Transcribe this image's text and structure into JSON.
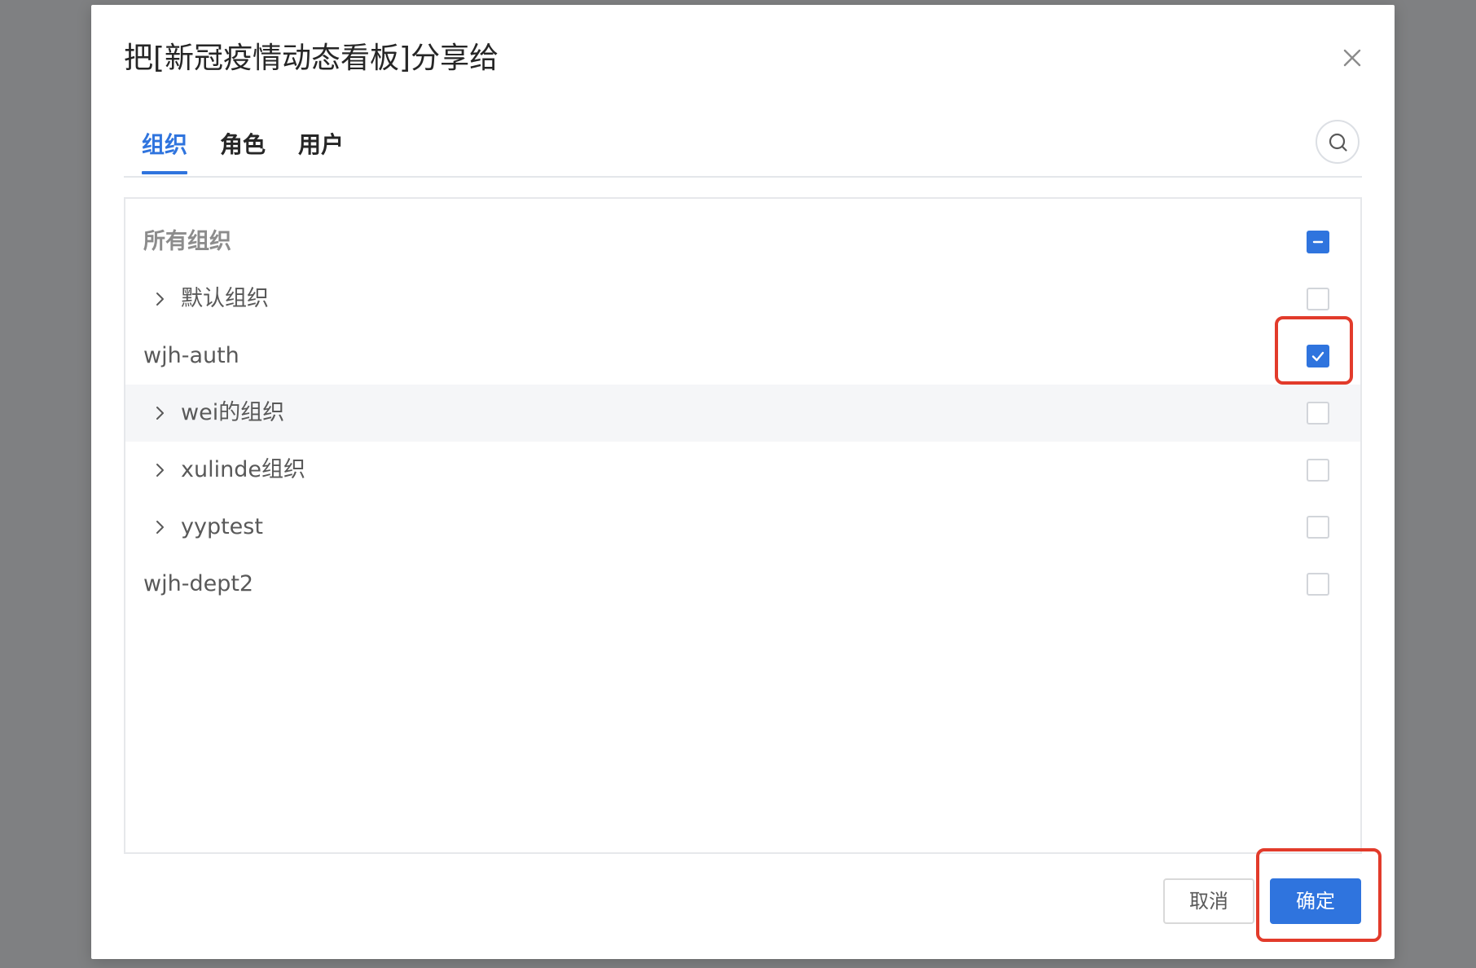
{
  "dialog": {
    "title": "把[新冠疫情动态看板]分享给",
    "close_icon": "close-icon"
  },
  "tabs": [
    {
      "label": "组织",
      "active": true
    },
    {
      "label": "角色",
      "active": false
    },
    {
      "label": "用户",
      "active": false
    }
  ],
  "search": {
    "icon": "search-icon"
  },
  "tree": {
    "root_label": "所有组织",
    "root_state": "indeterminate",
    "items": [
      {
        "label": "默认组织",
        "expandable": true,
        "checked": false
      },
      {
        "label": "wjh-auth",
        "expandable": false,
        "checked": true
      },
      {
        "label": "wei的组织",
        "expandable": true,
        "checked": false
      },
      {
        "label": "xulinde组织",
        "expandable": true,
        "checked": false
      },
      {
        "label": "yyptest",
        "expandable": true,
        "checked": false
      },
      {
        "label": "wjh-dept2",
        "expandable": false,
        "checked": false
      }
    ]
  },
  "footer": {
    "cancel_label": "取消",
    "ok_label": "确定"
  },
  "colors": {
    "primary": "#2f74de",
    "annotation": "#e23b2b",
    "overlay": "#7f8082"
  }
}
